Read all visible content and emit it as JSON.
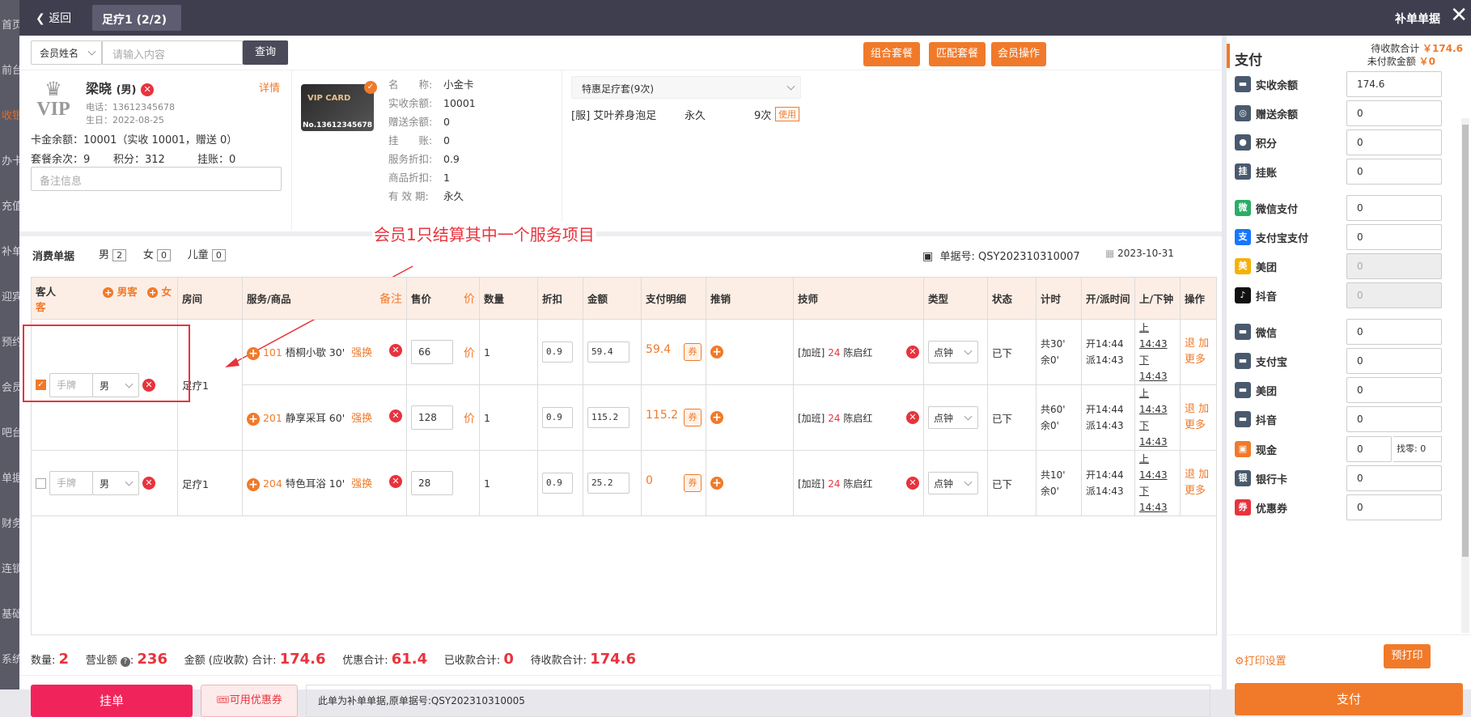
{
  "sidebar": [
    "首页",
    "前台",
    "收银",
    "办卡",
    "充值",
    "补单",
    "迎宾",
    "预约",
    "会员",
    "吧台",
    "单据",
    "财务",
    "连锁",
    "基础",
    "系统"
  ],
  "topbar": {
    "back": "返回",
    "tab": "足疗1 (2/2)",
    "right_title": "补单单据"
  },
  "search": {
    "field": "会员姓名",
    "placeholder": "请输入内容",
    "button": "查询"
  },
  "actions": {
    "combo": "组合套餐",
    "match": "匹配套餐",
    "member_op": "会员操作"
  },
  "member": {
    "vip": "VIP",
    "name": "梁晓",
    "gender": "(男)",
    "detail": "详情",
    "phone": "电话：13612345678",
    "birthday": "生日：2022-08-25",
    "balance": "卡金余额：10001（实收 10001，赠送 0）",
    "times": "套餐余次：9",
    "points": "积分：312",
    "credit": "挂账：0",
    "note_placeholder": "备注信息"
  },
  "card": {
    "label": "VIP CARD",
    "no": "No.13612345678",
    "rows": [
      {
        "k": "名　　称:",
        "v": "小金卡"
      },
      {
        "k": "实收余额:",
        "v": "10001"
      },
      {
        "k": "赠送余额:",
        "v": "0"
      },
      {
        "k": "挂　　账:",
        "v": "0"
      },
      {
        "k": "服务折扣:",
        "v": "0.9"
      },
      {
        "k": "商品折扣:",
        "v": "1"
      },
      {
        "k": "有 效 期:",
        "v": "永久"
      }
    ]
  },
  "package": {
    "select": "特惠足疗套(9次)",
    "item": "[服] 艾叶养身泡足",
    "term": "永久",
    "count": "9次",
    "use": "使用"
  },
  "annotation": "会员1只结算其中一个服务项目",
  "bill": {
    "title": "消费单据",
    "male": "男",
    "male_n": "2",
    "female": "女",
    "female_n": "0",
    "child": "儿童",
    "child_n": "0",
    "no": "单据号: QSY202310310007",
    "date": "2023-10-31"
  },
  "headers": {
    "guest": "客人",
    "add_male": "男客",
    "add_female": "女客",
    "room": "房间",
    "service": "服务/商品",
    "remark": "备注",
    "price": "售价",
    "price_btn": "价",
    "qty": "数量",
    "discount": "折扣",
    "amount": "金额",
    "paydetail": "支付明细",
    "promo": "推销",
    "tech": "技师",
    "type": "类型",
    "status": "状态",
    "timing": "计时",
    "opentime": "开/派时间",
    "clock": "上/下钟",
    "op": "操作"
  },
  "rows": [
    {
      "hand": "手牌",
      "gender": "男",
      "room": "足疗1",
      "code": "101",
      "svc": "梧桐小歇 30'",
      "swap": "强换",
      "price": "66",
      "qty": "1",
      "disc": "0.9",
      "amt": "59.4",
      "paid": "59.4",
      "quan": "券",
      "tech_pre": "[加班]",
      "tech_no": "24",
      "tech_name": "陈启红",
      "type": "点钟",
      "status": "已下",
      "t1": "共30'",
      "t2": "余0'",
      "o1": "开14:44",
      "o2": "派14:43",
      "c1": "上14:43",
      "c2": "下14:43",
      "op1": "退 加",
      "op2": "更多",
      "checked": true
    },
    {
      "code": "201",
      "svc": "静享采耳 60'",
      "swap": "强换",
      "price": "128",
      "qty": "1",
      "disc": "0.9",
      "amt": "115.2",
      "paid": "115.2",
      "quan": "券",
      "tech_pre": "[加班]",
      "tech_no": "24",
      "tech_name": "陈启红",
      "type": "点钟",
      "status": "已下",
      "t1": "共60'",
      "t2": "余0'",
      "o1": "开14:44",
      "o2": "派14:43",
      "c1": "上14:43",
      "c2": "下14:43",
      "op1": "退 加",
      "op2": "更多"
    },
    {
      "hand": "手牌",
      "gender": "男",
      "room": "足疗1",
      "code": "204",
      "svc": "特色耳浴 10'",
      "swap": "强换",
      "price": "28",
      "qty": "1",
      "disc": "0.9",
      "amt": "25.2",
      "paid": "0",
      "quan": "券",
      "tech_pre": "[加班]",
      "tech_no": "24",
      "tech_name": "陈启红",
      "type": "点钟",
      "status": "已下",
      "t1": "共10'",
      "t2": "余0'",
      "o1": "开14:44",
      "o2": "派14:43",
      "c1": "上14:43",
      "c2": "下14:43",
      "op1": "退 加",
      "op2": "更多",
      "checked": false
    }
  ],
  "summary": {
    "count_l": "数量:",
    "count": "2",
    "rev_l": "营业额",
    "rev": "236",
    "amt_l": "金额 (应收款) 合计:",
    "amt": "174.6",
    "disc_l": "优惠合计:",
    "disc": "61.4",
    "recv_l": "已收款合计:",
    "recv": "0",
    "pend_l": "待收款合计:",
    "pend": "174.6"
  },
  "footer": {
    "hang": "挂单",
    "coupon": "可用优惠券",
    "remark": "此单为补单单据,原单据号:QSY202310310005"
  },
  "pay": {
    "title": "支付",
    "pending_l": "待收款合计",
    "pending": "￥174.6",
    "unpaid_l": "未付款金额",
    "unpaid": "￥0",
    "methods": [
      {
        "label": "实收余额",
        "value": "174.6",
        "color": "#4a5a6e",
        "ic": "▬"
      },
      {
        "label": "赠送余额",
        "value": "0",
        "color": "#4a5a6e",
        "ic": "◎"
      },
      {
        "label": "积分",
        "value": "0",
        "color": "#4a5a6e",
        "ic": "●"
      },
      {
        "label": "挂账",
        "value": "0",
        "color": "#4a5a6e",
        "ic": "挂"
      },
      {
        "label": "微信支付",
        "value": "0",
        "color": "#2aae67",
        "ic": "微"
      },
      {
        "label": "支付宝支付",
        "value": "0",
        "color": "#1677ff",
        "ic": "支"
      },
      {
        "label": "美团",
        "value": "0",
        "color": "#f5b10a",
        "ic": "美"
      },
      {
        "label": "抖音",
        "value": "0",
        "color": "#111111",
        "ic": "♪"
      },
      {
        "label": "微信",
        "value": "0",
        "color": "#4a5a6e",
        "ic": "▬"
      },
      {
        "label": "支付宝",
        "value": "0",
        "color": "#4a5a6e",
        "ic": "▬"
      },
      {
        "label": "美团",
        "value": "0",
        "color": "#4a5a6e",
        "ic": "▬"
      },
      {
        "label": "抖音",
        "value": "0",
        "color": "#4a5a6e",
        "ic": "▬"
      },
      {
        "label": "现金",
        "value": "0",
        "color": "#f07a2a",
        "ic": "▣"
      },
      {
        "label": "银行卡",
        "value": "0",
        "color": "#4a5a6e",
        "ic": "银"
      },
      {
        "label": "优惠券",
        "value": "0",
        "color": "#e8333d",
        "ic": "券"
      }
    ],
    "change_l": "找零:",
    "change": "0",
    "print_set": "打印设置",
    "preprint": "预打印",
    "pay_btn": "支付"
  }
}
